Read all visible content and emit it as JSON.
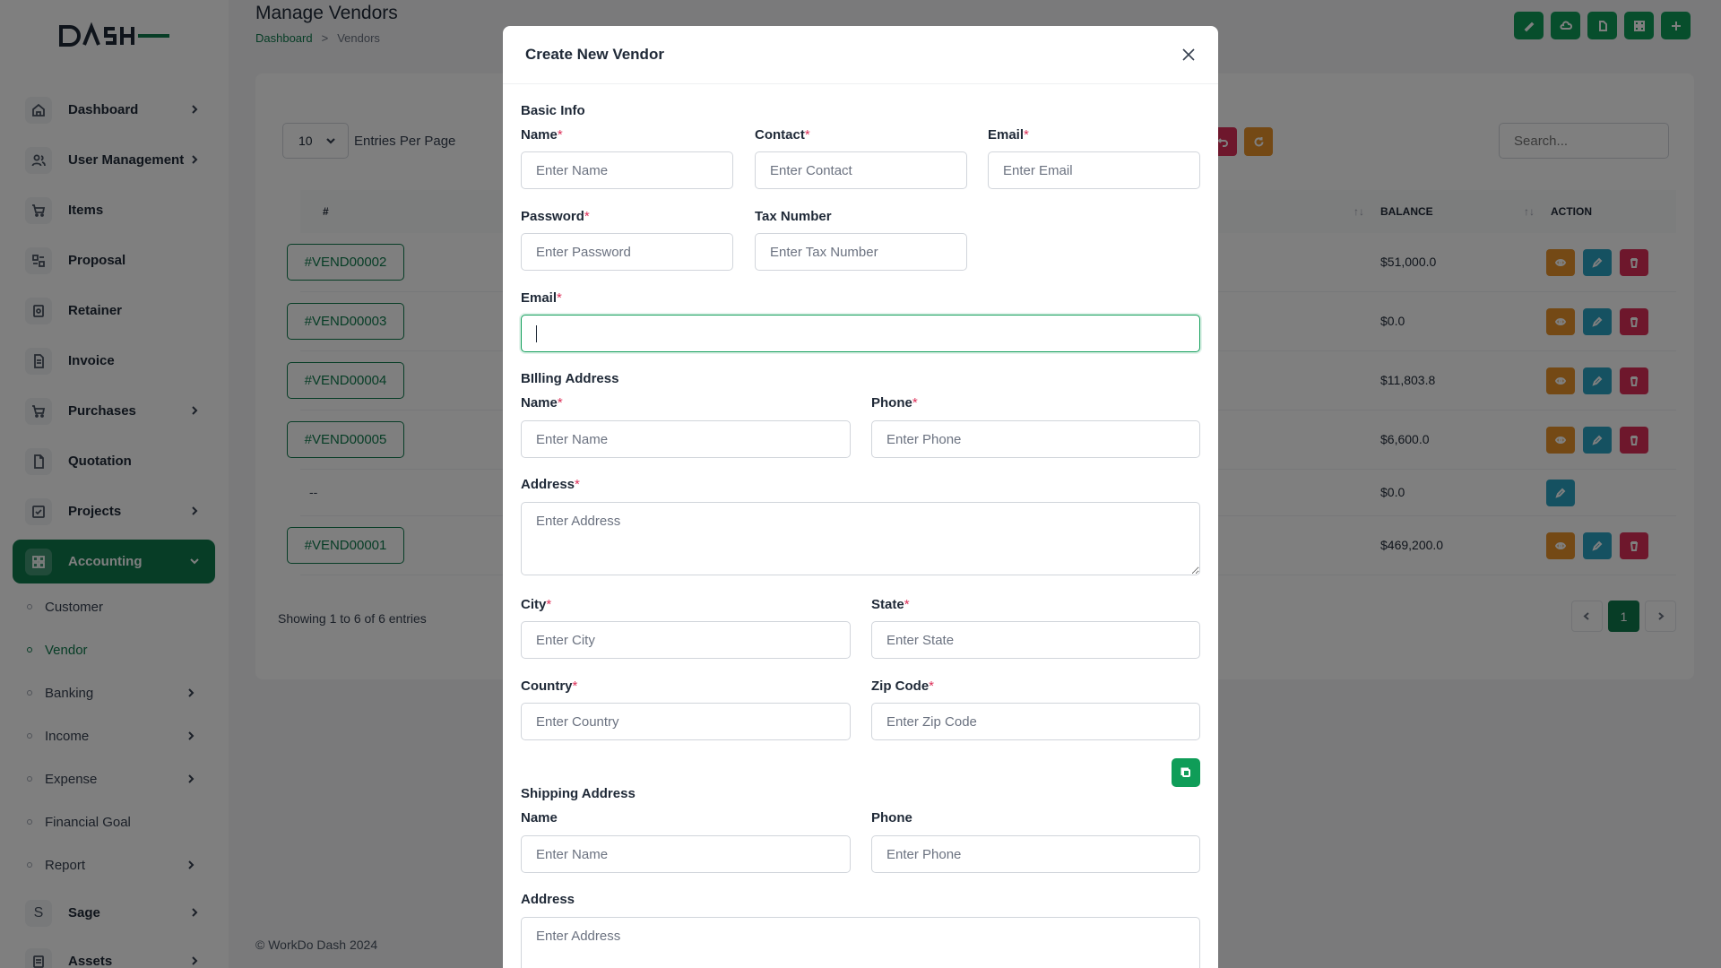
{
  "brand": {
    "logo_text": "DASH"
  },
  "sidebar": {
    "items": [
      {
        "label": "Dashboard",
        "icon": "home-icon"
      },
      {
        "label": "User Management",
        "icon": "users-icon"
      },
      {
        "label": "Items",
        "icon": "cart-icon"
      },
      {
        "label": "Proposal",
        "icon": "proposal-icon"
      },
      {
        "label": "Retainer",
        "icon": "retainer-icon"
      },
      {
        "label": "Invoice",
        "icon": "invoice-icon"
      },
      {
        "label": "Purchases",
        "icon": "cart-icon"
      },
      {
        "label": "Quotation",
        "icon": "file-icon"
      },
      {
        "label": "Projects",
        "icon": "check-square-icon"
      },
      {
        "label": "Accounting",
        "icon": "grid-icon"
      }
    ],
    "accounting_sub": [
      {
        "label": "Customer"
      },
      {
        "label": "Vendor"
      },
      {
        "label": "Banking"
      },
      {
        "label": "Income"
      },
      {
        "label": "Expense"
      },
      {
        "label": "Financial Goal"
      },
      {
        "label": "Report"
      }
    ],
    "bottom_items": [
      {
        "label": "Sage",
        "icon": "s-letter-icon"
      },
      {
        "label": "Assets",
        "icon": "assets-icon"
      }
    ]
  },
  "header": {
    "title": "Manage Vendors",
    "breadcrumb": {
      "home": "Dashboard",
      "sep": ">",
      "current": "Vendors"
    }
  },
  "table": {
    "entries_value": "10",
    "entries_label": "Entries Per Page",
    "search_placeholder": "Search...",
    "columns": {
      "id": "#",
      "balance": "BALANCE",
      "action": "ACTION"
    },
    "rows": [
      {
        "id": "#VEND00002",
        "balance": "$51,000.0"
      },
      {
        "id": "#VEND00003",
        "balance": "$0.0"
      },
      {
        "id": "#VEND00004",
        "balance": "$11,803.8"
      },
      {
        "id": "#VEND00005",
        "balance": "$6,600.0"
      },
      {
        "id": "--",
        "balance": "$0.0"
      },
      {
        "id": "#VEND00001",
        "balance": "$469,200.0"
      }
    ],
    "showing": "Showing 1 to 6 of 6 entries",
    "current_page": "1"
  },
  "footer": {
    "text": "© WorkDo Dash 2024"
  },
  "modal": {
    "title": "Create New Vendor",
    "basic_info": {
      "title": "Basic Info",
      "name_label": "Name",
      "name_placeholder": "Enter Name",
      "contact_label": "Contact",
      "contact_placeholder": "Enter Contact",
      "email_label": "Email",
      "email_placeholder": "Enter Email",
      "password_label": "Password",
      "password_placeholder": "Enter Password",
      "tax_label": "Tax Number",
      "tax_placeholder": "Enter Tax Number",
      "email2_label": "Email",
      "email2_value": ""
    },
    "billing": {
      "title": "BIlling Address",
      "name_label": "Name",
      "name_placeholder": "Enter Name",
      "phone_label": "Phone",
      "phone_placeholder": "Enter Phone",
      "address_label": "Address",
      "address_placeholder": "Enter Address",
      "city_label": "City",
      "city_placeholder": "Enter City",
      "state_label": "State",
      "state_placeholder": "Enter State",
      "country_label": "Country",
      "country_placeholder": "Enter Country",
      "zip_label": "Zip Code",
      "zip_placeholder": "Enter Zip Code"
    },
    "shipping": {
      "title": "Shipping Address",
      "name_label": "Name",
      "name_placeholder": "Enter Name",
      "phone_label": "Phone",
      "phone_placeholder": "Enter Phone",
      "address_label": "Address",
      "address_placeholder": "Enter Address"
    },
    "required_mark": "*"
  },
  "colors": {
    "brand_green": "#0f7a4d",
    "accent_green": "#0f9d58",
    "view_orange": "#e8922a",
    "edit_teal": "#2aa3c2",
    "delete_red": "#dc2f58"
  }
}
